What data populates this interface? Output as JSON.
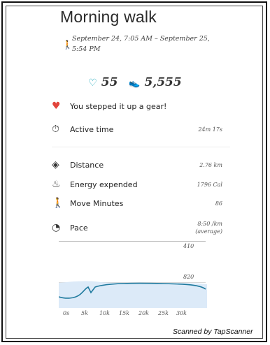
{
  "activity": {
    "title": "Morning walk",
    "date_range": "September 24, 7:05 AM – September 25, 5:54 PM",
    "heart_points": "55",
    "steps": "5,555"
  },
  "banner": "You stepped it up a gear!",
  "metrics": {
    "active_time": {
      "label": "Active time",
      "value": "24m 17s"
    },
    "distance": {
      "label": "Distance",
      "value": "2.76 km"
    },
    "energy": {
      "label": "Energy expended",
      "value": "1796 Cal"
    },
    "move_minutes": {
      "label": "Move Minutes",
      "value": "86"
    },
    "pace": {
      "label": "Pace",
      "value": "8:50 /km",
      "value_note": "(average)"
    }
  },
  "chart": {
    "y_top_label": "410",
    "y_mid_label": "820",
    "x_labels": [
      "0s",
      "5k",
      "10k",
      "15k",
      "20k",
      "25k",
      "30k"
    ],
    "line_color": "#1f7a9e",
    "fill_color": "#dceaf8"
  },
  "footer": "Scanned by TapScanner"
}
